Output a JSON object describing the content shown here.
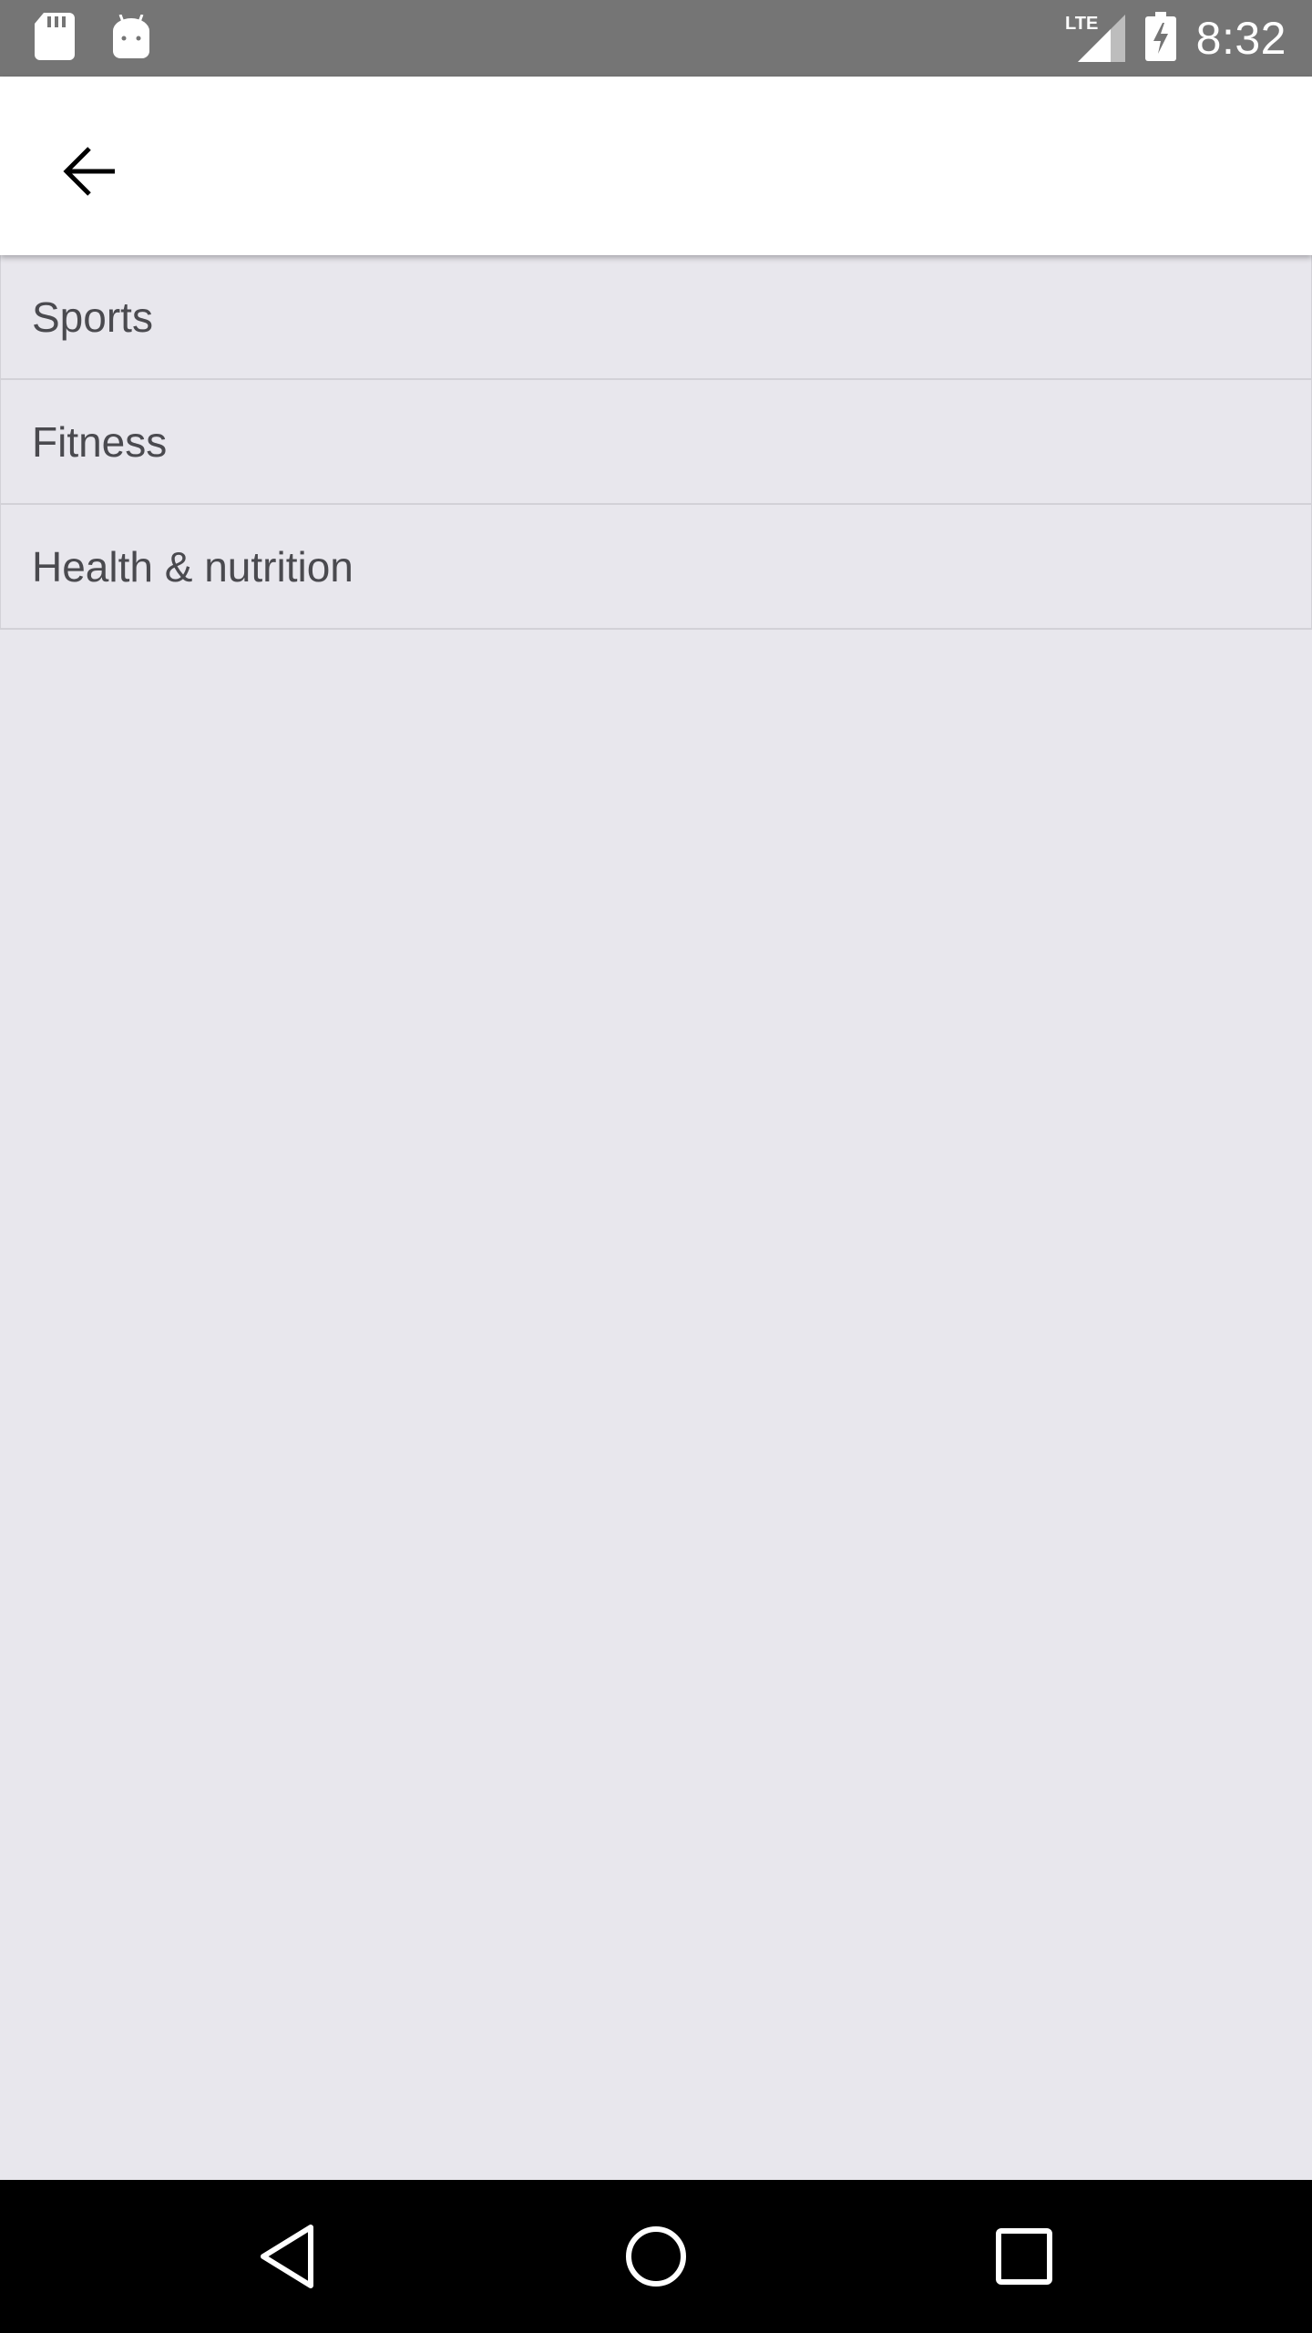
{
  "status_bar": {
    "time": "8:32",
    "network": "LTE",
    "icons": [
      "sd-card-icon",
      "android-icon",
      "lte-signal-icon",
      "battery-charging-icon"
    ],
    "background": "#757575"
  },
  "app_bar": {
    "back_icon": "arrow-back-icon",
    "background": "#FFFFFF"
  },
  "categories": {
    "items": [
      {
        "label": "Sports"
      },
      {
        "label": "Fitness"
      },
      {
        "label": "Health & nutrition"
      }
    ]
  },
  "nav_bar": {
    "icons": [
      "nav-back-icon",
      "nav-home-icon",
      "nav-recents-icon"
    ],
    "background": "#000000"
  },
  "colors": {
    "page_background": "#E8E7ED",
    "divider": "#D2D1D7",
    "list_text": "#4A4A4F"
  }
}
